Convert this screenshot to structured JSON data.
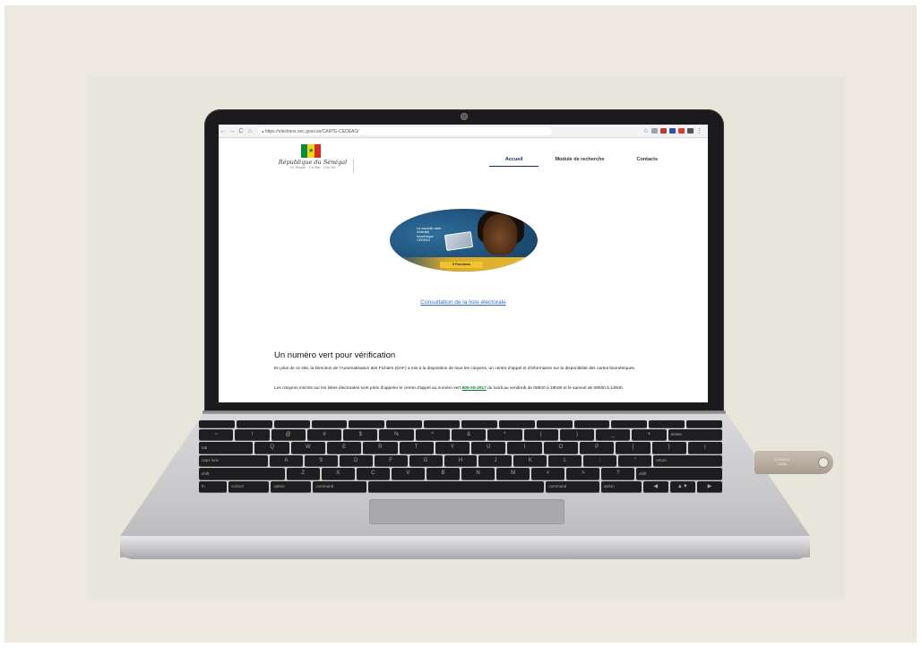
{
  "browser": {
    "url": "https://elections.sec.gouv.sn/CARTE-CEDEAO/",
    "nav_back": "←",
    "nav_forward": "→",
    "nav_reload": "C",
    "nav_home": "⌂",
    "lock": "🔒",
    "star": "☆",
    "menu_dots": "⋮"
  },
  "site": {
    "republic_title": "République du Sénégal",
    "republic_motto": "Un Peuple · Un But · Une Foi",
    "nav": [
      {
        "label": "Accueil",
        "active": true
      },
      {
        "label": "Module de recherche",
        "active": false
      },
      {
        "label": "Contacts",
        "active": false
      }
    ],
    "hero": {
      "text": "La nouvelle carte d'identité biométrique CEDEAO",
      "label": "5 Fonctions"
    },
    "consult_link": "Consultation de la liste électorale",
    "section_title": "Un numéro vert pour vérification",
    "para1": "En plus de ce site, la Direction de l'Automatisation des Fichiers (DAF) a mis à la disposition de tous les citoyens, un centre d'appel et d'information sur la disponibilité des cartes biométriques.",
    "para2_start": "Les citoyens inscrits sur les listes électorales sont priés d'appeler le centre d'appel au numéro vert ",
    "green_number": "800-00-2017",
    "para2_end": " du lundi au vendredi de 08h00 à 18h00 et le samedi de 09h00 à 13h00."
  },
  "keyboard": {
    "row1": [
      "~",
      "!",
      "@",
      "#",
      "$",
      "%",
      "^",
      "&",
      "*",
      "(",
      ")",
      "_",
      "+",
      "delete"
    ],
    "row2": [
      "tab",
      "Q",
      "W",
      "E",
      "R",
      "T",
      "Y",
      "U",
      "I",
      "O",
      "P",
      "{",
      "}",
      "|"
    ],
    "row3": [
      "caps lock",
      "A",
      "S",
      "D",
      "F",
      "G",
      "H",
      "J",
      "K",
      "L",
      ":",
      "\"",
      "return"
    ],
    "row4": [
      "shift",
      "Z",
      "X",
      "C",
      "V",
      "B",
      "N",
      "M",
      "<",
      ">",
      "?",
      "shift"
    ],
    "row5": [
      "fn",
      "control",
      "option",
      "command",
      "",
      "command",
      "option",
      "◀",
      "▲▼",
      "▶"
    ]
  },
  "usb": {
    "line1": "DT100G3",
    "line2": "16GB"
  },
  "colors": {
    "flag_green": "#0a8a3a",
    "flag_yellow": "#f5d21a",
    "flag_red": "#d62b20",
    "link_blue": "#2a6bd8",
    "green_number": "#137a33"
  }
}
